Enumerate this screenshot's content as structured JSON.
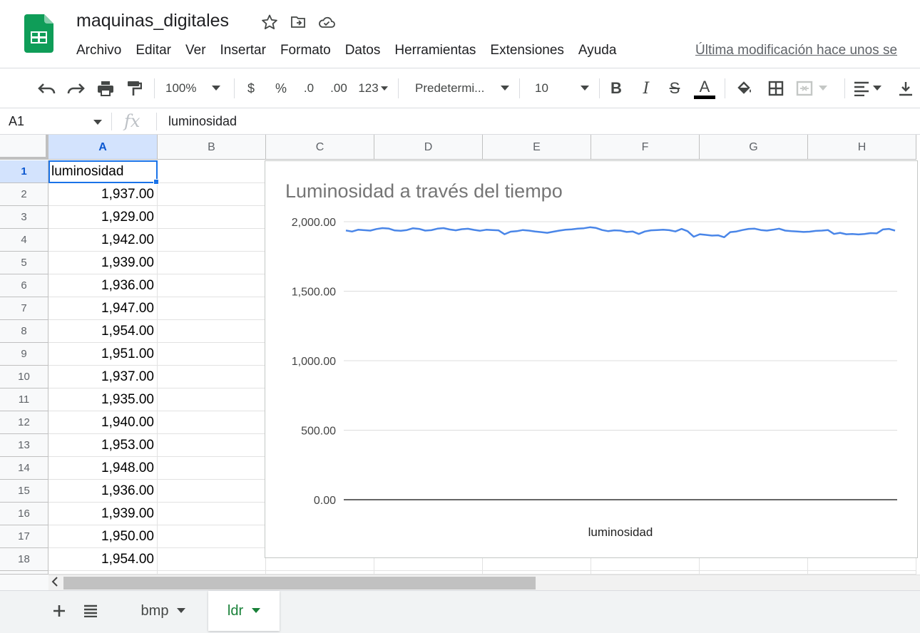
{
  "doc": {
    "title": "maquinas_digitales",
    "last_edit": "Última modificación hace unos se"
  },
  "icons": {
    "app": "google-sheets-logo",
    "star": "star-icon",
    "move": "move-to-folder-icon",
    "cloud": "cloud-saved-icon"
  },
  "menu": [
    "Archivo",
    "Editar",
    "Ver",
    "Insertar",
    "Formato",
    "Datos",
    "Herramientas",
    "Extensiones",
    "Ayuda"
  ],
  "toolbar": {
    "zoom": "100%",
    "currency": "$",
    "percent": "%",
    "decrease_decimals": ".0",
    "increase_decimals": ".00",
    "more_formats": "123",
    "font": "Predetermi...",
    "font_size": "10",
    "bold": "B",
    "italic": "I",
    "strike": "S",
    "text_color": "A"
  },
  "formula_bar": {
    "name_box": "A1",
    "fx": "fx",
    "content": "luminosidad"
  },
  "columns": [
    "A",
    "B",
    "C",
    "D",
    "E",
    "F",
    "G",
    "H"
  ],
  "rows": [
    "1",
    "2",
    "3",
    "4",
    "5",
    "6",
    "7",
    "8",
    "9",
    "10",
    "11",
    "12",
    "13",
    "14",
    "15",
    "16",
    "17",
    "18"
  ],
  "cells_a": [
    "luminosidad",
    "1,937.00",
    "1,929.00",
    "1,942.00",
    "1,939.00",
    "1,936.00",
    "1,947.00",
    "1,954.00",
    "1,951.00",
    "1,937.00",
    "1,935.00",
    "1,940.00",
    "1,953.00",
    "1,948.00",
    "1,936.00",
    "1,939.00",
    "1,950.00",
    "1,954.00"
  ],
  "chart_data": {
    "type": "line",
    "title": "Luminosidad a través del tiempo",
    "xlabel": "luminosidad",
    "ylabel": "",
    "ylim": [
      0,
      2000
    ],
    "yticks": [
      "0.00",
      "500.00",
      "1,000.00",
      "1,500.00",
      "2,000.00"
    ],
    "grid": true,
    "series": [
      {
        "name": "luminosidad",
        "color": "#4a86e8",
        "values": [
          1937,
          1929,
          1942,
          1939,
          1936,
          1947,
          1954,
          1951,
          1937,
          1935,
          1940,
          1953,
          1948,
          1936,
          1939,
          1950,
          1954,
          1944,
          1938,
          1946,
          1949,
          1941,
          1935,
          1942,
          1940,
          1938,
          1910,
          1928,
          1932,
          1940,
          1936,
          1930,
          1925,
          1920,
          1928,
          1936,
          1942,
          1945,
          1950,
          1953,
          1960,
          1955,
          1940,
          1932,
          1938,
          1936,
          1926,
          1930,
          1912,
          1930,
          1938,
          1940,
          1942,
          1939,
          1930,
          1948,
          1932,
          1892,
          1910,
          1905,
          1900,
          1902,
          1888,
          1925,
          1930,
          1940,
          1948,
          1950,
          1940,
          1936,
          1942,
          1950,
          1936,
          1932,
          1930,
          1926,
          1928,
          1934,
          1936,
          1940,
          1912,
          1920,
          1910,
          1912,
          1908,
          1912,
          1918,
          1916,
          1944,
          1948,
          1936
        ]
      }
    ]
  },
  "sheets": {
    "tab1": "bmp",
    "tab2": "ldr"
  }
}
